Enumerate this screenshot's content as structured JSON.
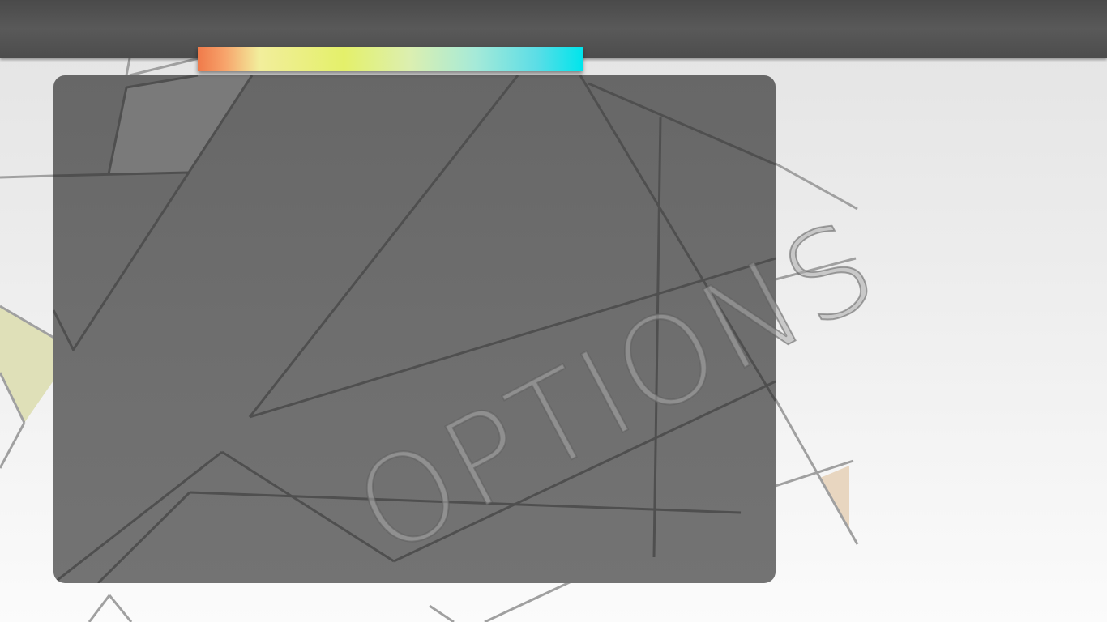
{
  "watermark": {
    "label": "OPTIONS"
  },
  "color_strip": {
    "gradient_stops": [
      "#f07a4a",
      "#f7a36b",
      "#f2ee9c",
      "#e4f06a",
      "#dcefb0",
      "#a6ead8",
      "#5cdde6",
      "#00e5ec"
    ]
  },
  "colors": {
    "top_bar": "#555555",
    "panel": "#6c6c6c",
    "background": "#ececec",
    "line_dark": "#4f4f4f",
    "line_light": "#a0a0a0",
    "accent_yellow": "#dfe0b8",
    "accent_peach": "#e8d6c0"
  }
}
